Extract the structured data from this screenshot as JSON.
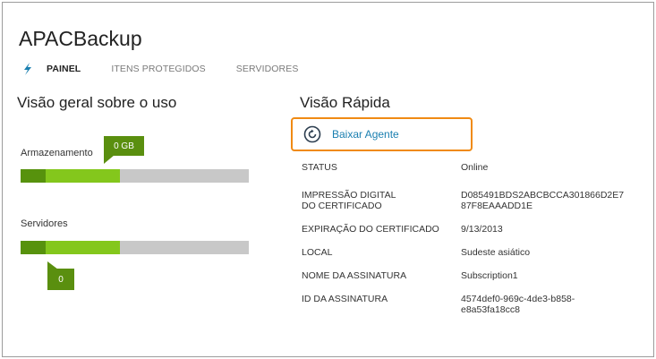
{
  "app": {
    "title": "APACBackup"
  },
  "nav": {
    "tabs": [
      {
        "label": "PAINEL",
        "active": true
      },
      {
        "label": "ITENS PROTEGIDOS",
        "active": false
      },
      {
        "label": "SERVIDORES",
        "active": false
      }
    ],
    "bolt_color": "#1a7fb0"
  },
  "usage": {
    "title": "Visão geral sobre o uso",
    "storage": {
      "label": "Armazenamento",
      "callout": "0 GB"
    },
    "servers": {
      "label": "Servidores",
      "callout": "0"
    },
    "colors": {
      "dark_green": "#57920d",
      "light_green": "#84c71c",
      "track": "#c8c8c8"
    }
  },
  "quick": {
    "title": "Visão Rápida",
    "download_agent": {
      "label": "Baixar Agente",
      "icon": "sync-icon"
    },
    "highlight_color": "#f08a13",
    "rows": [
      {
        "key": "STATUS",
        "value": "Online"
      },
      {
        "key": "IMPRESSÃO DIGITAL",
        "key2": "DO CERTIFICADO",
        "value": "D085491BDS2ABCBCCA301866D2E7",
        "value2": "87F8EAAADD1E"
      },
      {
        "key": "EXPIRAÇÃO DO CERTIFICADO",
        "value": "9/13/2013"
      },
      {
        "key": "LOCAL",
        "value": "Sudeste asiático"
      },
      {
        "key": "NOME DA ASSINATURA",
        "value": "Subscription1"
      },
      {
        "key": "ID DA ASSINATURA",
        "value": "4574def0-969c-4de3-b858-",
        "value2": "e8a53fa18cc8"
      }
    ]
  }
}
